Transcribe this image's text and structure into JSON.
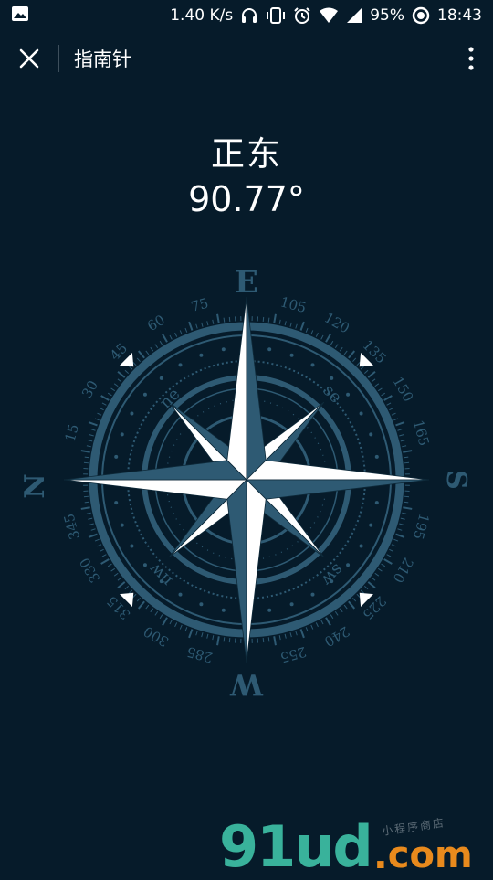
{
  "status_bar": {
    "speed": "1.40 K/s",
    "battery": "95%",
    "time": "18:43"
  },
  "app_bar": {
    "title": "指南针",
    "close_icon": "close-icon",
    "more_icon": "more-vertical-icon"
  },
  "compass": {
    "direction": "正东",
    "degrees": "90.77°",
    "heading_value": 90.77,
    "cardinals": {
      "top": "E",
      "right": "S",
      "bottom": "W",
      "left": "N"
    },
    "intercardinals": [
      "ne",
      "se",
      "sw",
      "nw"
    ],
    "tick_labels": [
      "15",
      "30",
      "45",
      "60",
      "75",
      "105",
      "120",
      "135",
      "150",
      "165",
      "195",
      "210",
      "225",
      "240",
      "255",
      "285",
      "300",
      "315",
      "330",
      "345"
    ],
    "colors": {
      "rose_dark": "#2e5a73",
      "rose_light": "#ffffff",
      "ring": "#2e5a73"
    }
  },
  "watermark": {
    "logo": "91ud",
    "domain_dot": ".",
    "domain": "com",
    "small_text": "小程序商店"
  }
}
